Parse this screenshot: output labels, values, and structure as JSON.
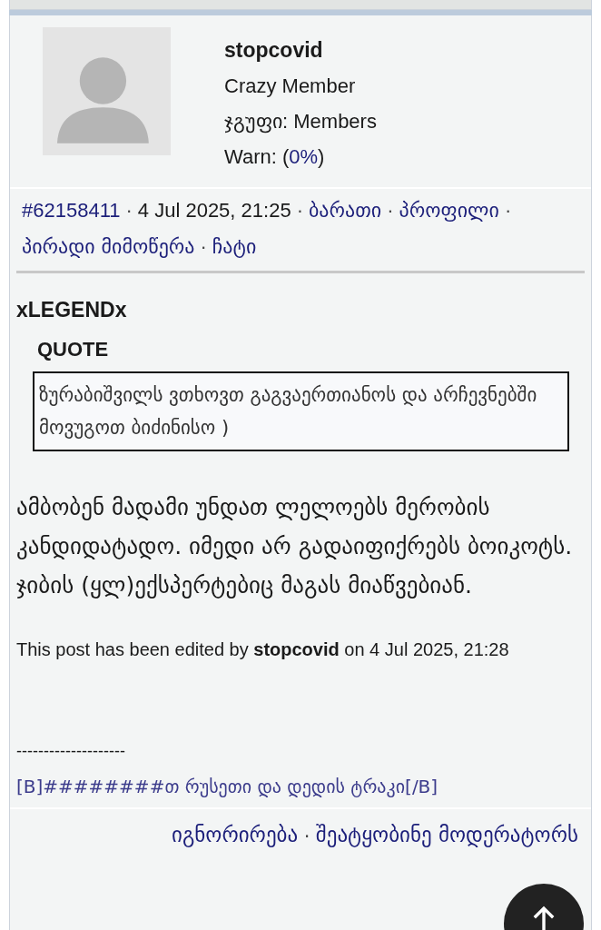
{
  "author": {
    "name": "stopcovid",
    "rank": "Crazy Member",
    "group_label": "ჯგუფი:",
    "group": "Members",
    "warn_label": "Warn:",
    "warn_open": "(",
    "warn_value": "0%",
    "warn_close": ")"
  },
  "separator": "·",
  "meta": {
    "post_id": "#62158411",
    "date": "4 Jul 2025, 21:25",
    "links": [
      "ბარათი",
      "პროფილი",
      "პირადი მიმოწერა",
      "ჩატი"
    ]
  },
  "post": {
    "quote_author": "xLEGENDx",
    "quote_label": "QUOTE",
    "quote_text": "ზურაბიშვილს ვთხოვთ გაგვაერთიანოს და არჩევნებში მოვუგოთ ბიძინისო )",
    "body": "ამბობენ მადამი უნდათ ლელოებს მერობის კანდიდატადო. იმედი არ გადაიფიქრებს ბოიკოტს. ჯიბის (ყლ)ექსპერტებიც მაგას მიაწვებიან.",
    "edited": "This post has been edited by **stopcovid** on 4 Jul 2025, 21:28"
  },
  "signature": {
    "rule": "--------------------",
    "text": "[B]########თ რუსეთი და დედის ტრაკი[/B]"
  },
  "footer": {
    "links": [
      "იგნორირება",
      "შეატყობინე მოდერატორს"
    ]
  }
}
